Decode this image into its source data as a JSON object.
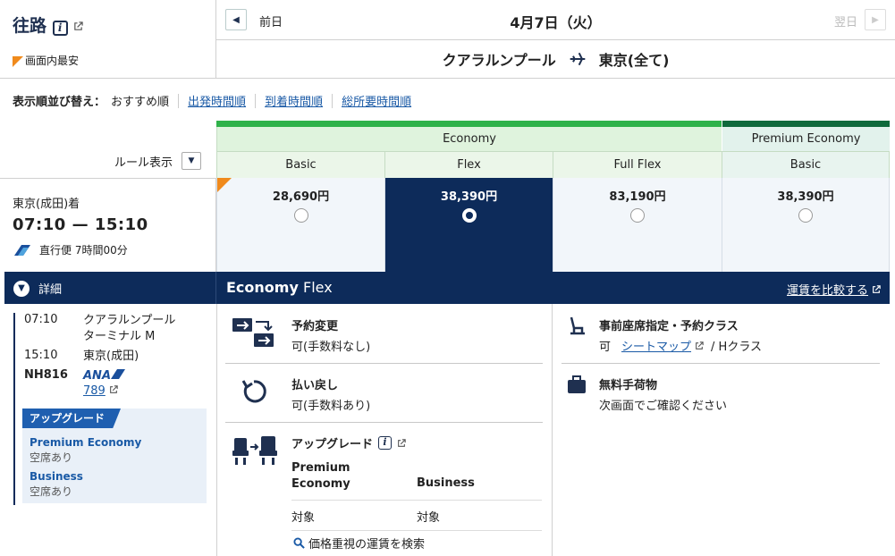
{
  "header": {
    "direction_title": "往路",
    "cheapest_label": "画面内最安",
    "prev_label": "前日",
    "date": "4月7日（火）",
    "next_label": "翌日",
    "origin": "クアラルンプール",
    "destination": "東京(全て)"
  },
  "sort": {
    "label": "表示順並び替え：",
    "current": "おすすめ順",
    "options": [
      "出発時間順",
      "到着時間順",
      "総所要時間順"
    ]
  },
  "fare_table": {
    "rule_label": "ルール表示",
    "cabins": [
      {
        "name": "Economy"
      },
      {
        "name": "Premium Economy"
      }
    ],
    "brands": [
      {
        "name": "Basic",
        "price": "28,690円",
        "selected": false,
        "cheapest": true
      },
      {
        "name": "Flex",
        "price": "38,390円",
        "selected": true,
        "cheapest": false
      },
      {
        "name": "Full Flex",
        "price": "83,190円",
        "selected": false,
        "cheapest": false
      },
      {
        "name": "Basic",
        "price": "38,390円",
        "selected": false,
        "cheapest": false
      }
    ],
    "colors": {
      "economy_bar": "#2fb24a",
      "premium_bar": "#0f6a3c",
      "selected": "#0d2b5a",
      "cheapest": "#f08a1c"
    }
  },
  "flight": {
    "arrival_label": "東京(成田)着",
    "times": "07:10 — 15:10",
    "direct": "直行便 7時間00分"
  },
  "detail_bar": {
    "detail_label": "詳細",
    "fare_cabin": "Economy",
    "fare_brand": "Flex",
    "compare_label": "運賃を比較する"
  },
  "itinerary": {
    "dep_time": "07:10",
    "dep_place": "クアラルンプール ターミナル M",
    "arr_time": "15:10",
    "arr_place": "東京(成田)",
    "flight_no": "NH816",
    "airline_logo": "ANA",
    "aircraft": "789"
  },
  "upgrade_box": {
    "tag": "アップグレード",
    "items": [
      {
        "name": "Premium Economy",
        "status": "空席あり"
      },
      {
        "name": "Business",
        "status": "空席あり"
      }
    ]
  },
  "conditions": {
    "change": {
      "title": "予約変更",
      "value": "可(手数料なし)"
    },
    "refund": {
      "title": "払い戻し",
      "value": "可(手数料あり)"
    },
    "upgrade": {
      "title": "アップグレード",
      "col1_line1": "Premium",
      "col1_line2": "Economy",
      "col2": "Business",
      "val1": "対象",
      "val2": "対象",
      "search_link": "価格重視の運賃を検索"
    },
    "seat": {
      "title": "事前座席指定・予約クラス",
      "prefix": "可",
      "link": "シートマップ",
      "suffix": "/ Hクラス"
    },
    "baggage": {
      "title": "無料手荷物",
      "value": "次画面でご確認ください"
    }
  }
}
